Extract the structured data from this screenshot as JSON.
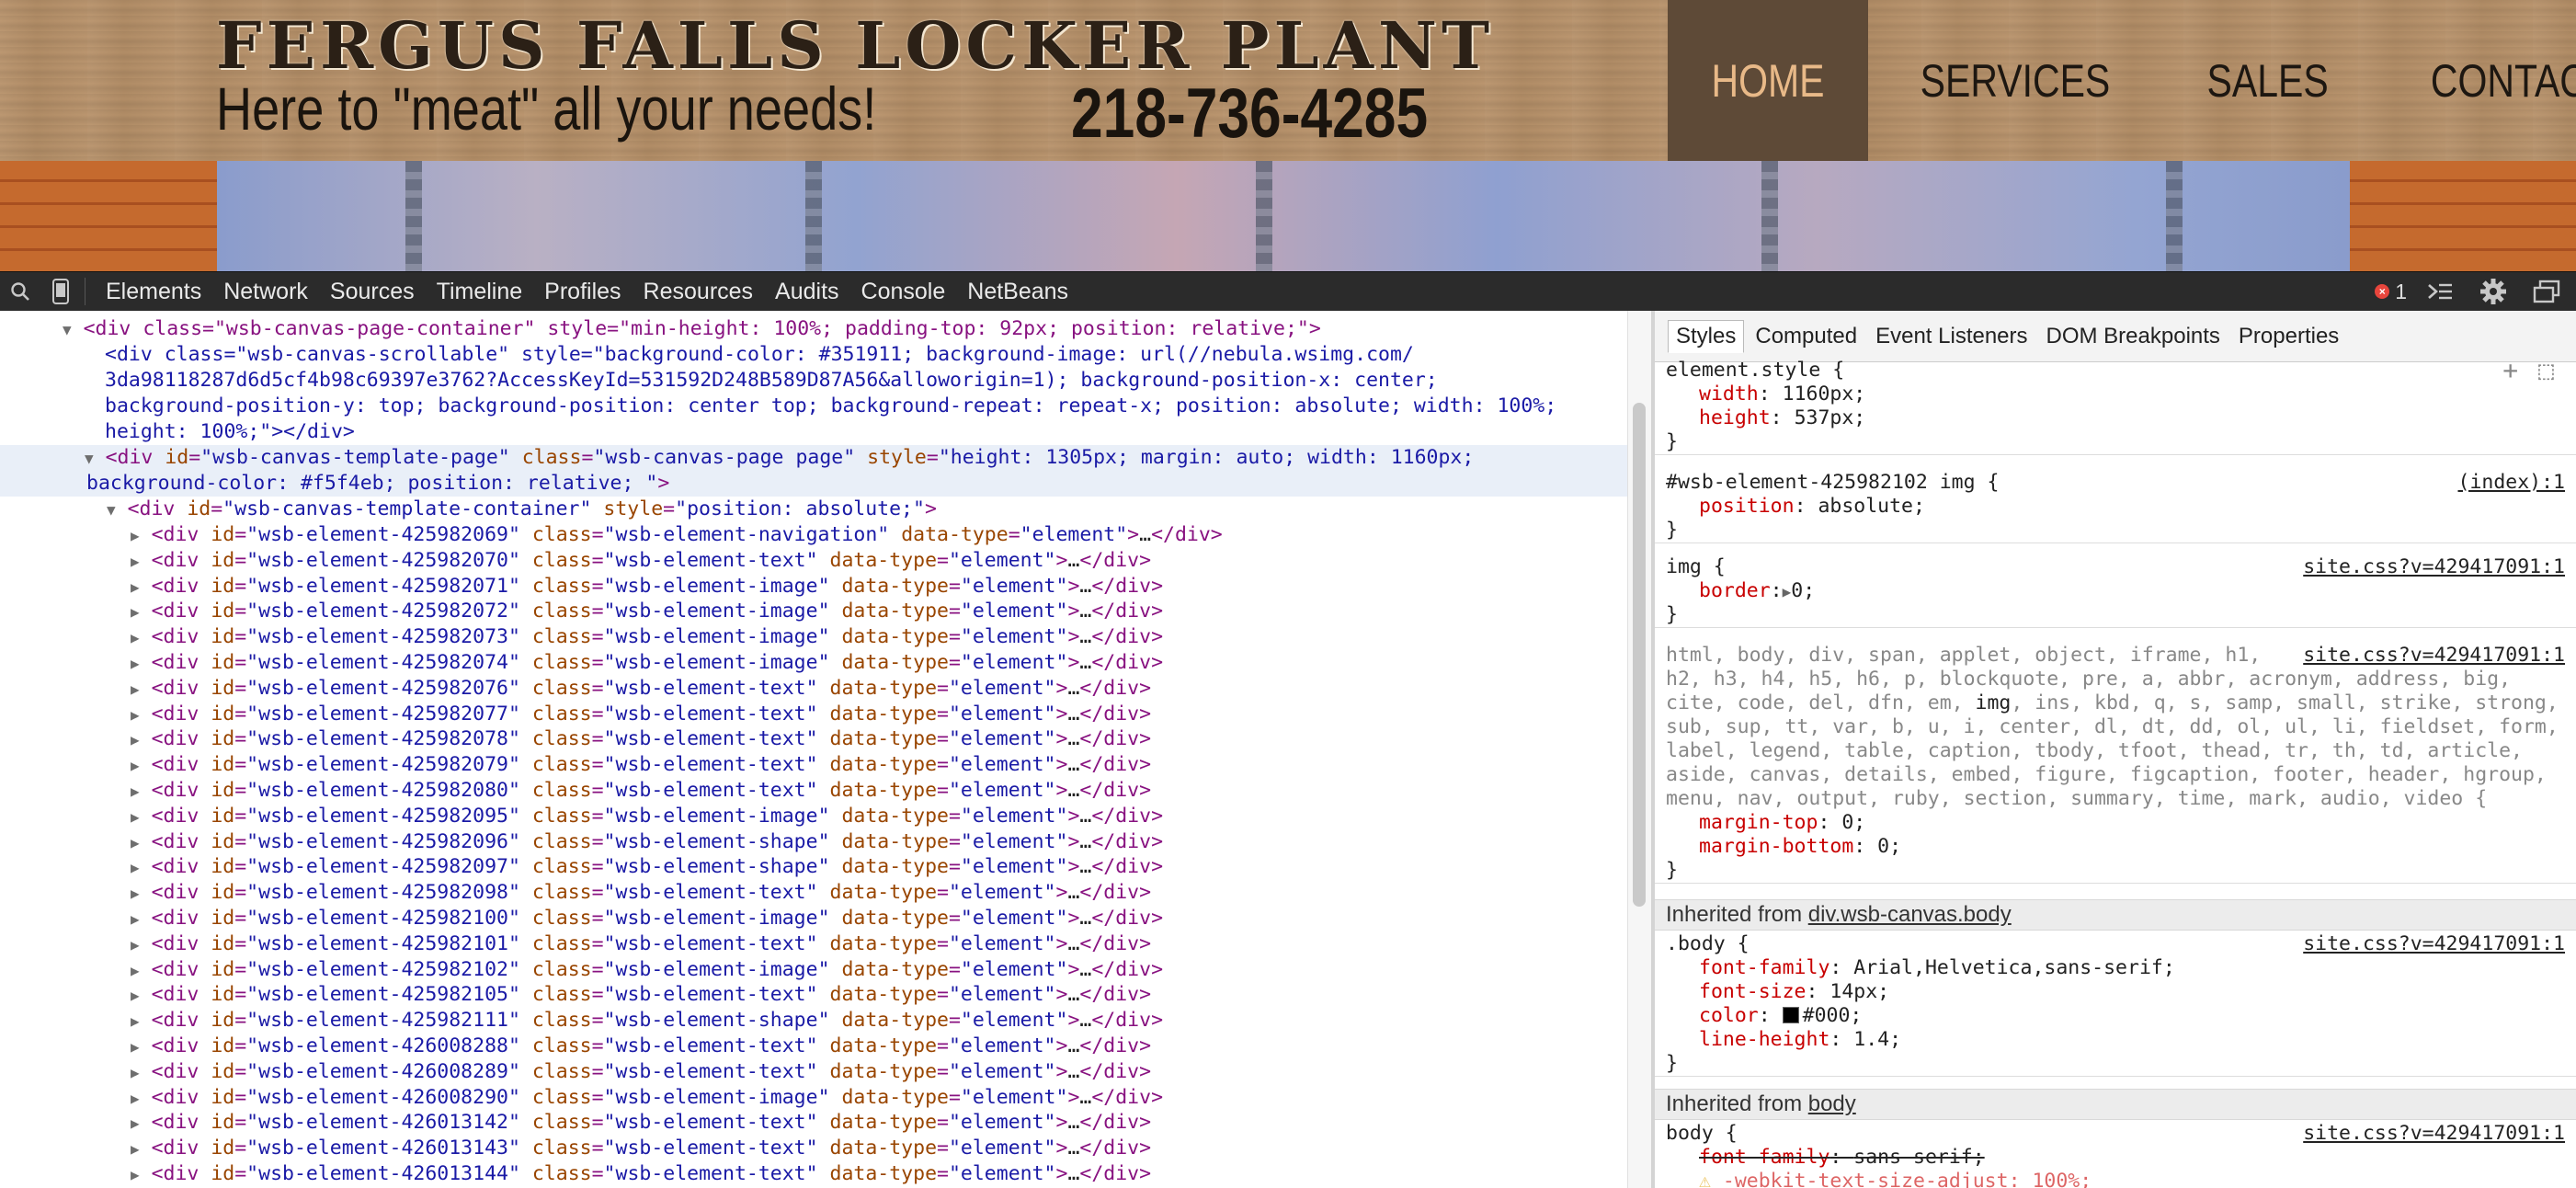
{
  "site": {
    "brand_title": "FERGUS FALLS LOCKER PLANT",
    "tagline": "Here to \"meat\" all your needs!",
    "phone": "218-736-4285",
    "nav": [
      "HOME",
      "SERVICES",
      "SALES",
      "CONTACT US"
    ],
    "active_nav": "HOME"
  },
  "devtools": {
    "tabs": [
      "Elements",
      "Network",
      "Sources",
      "Timeline",
      "Profiles",
      "Resources",
      "Audits",
      "Console",
      "NetBeans"
    ],
    "error_count": "1",
    "icons": [
      "search-icon",
      "device-mode-icon",
      "console-drawer-icon",
      "gear-icon",
      "dock-icon"
    ]
  },
  "elements": {
    "container_open": "<div class=\"wsb-canvas-page-container\" style=\"min-height: 100%; padding-top: 92px; position: relative;\">",
    "scrollable_lines": [
      "<div class=\"wsb-canvas-scrollable\" style=\"background-color: #351911; background-image: url(//nebula.wsimg.com/",
      "3da98118287d6d5cf4b98c69397e3762?AccessKeyId=531592D248B589D87A56&alloworigin=1); background-position-x: center;",
      "background-position-y: top; background-position: center top; background-repeat: repeat-x; position: absolute; width: 100%;",
      "height: 100%;\"></div>"
    ],
    "template_page": {
      "id": "wsb-canvas-template-page",
      "class": "wsb-canvas-page page",
      "style_line1": "height: 1305px; margin: auto; width: 1160px;",
      "style_line2": "background-color: #f5f4eb; position: relative; "
    },
    "template_container": {
      "id": "wsb-canvas-template-container",
      "style": "position: absolute;"
    },
    "element_rows": [
      {
        "id": "wsb-element-425982069",
        "cls": "wsb-element-navigation"
      },
      {
        "id": "wsb-element-425982070",
        "cls": "wsb-element-text"
      },
      {
        "id": "wsb-element-425982071",
        "cls": "wsb-element-image"
      },
      {
        "id": "wsb-element-425982072",
        "cls": "wsb-element-image"
      },
      {
        "id": "wsb-element-425982073",
        "cls": "wsb-element-image"
      },
      {
        "id": "wsb-element-425982074",
        "cls": "wsb-element-image"
      },
      {
        "id": "wsb-element-425982076",
        "cls": "wsb-element-text"
      },
      {
        "id": "wsb-element-425982077",
        "cls": "wsb-element-text"
      },
      {
        "id": "wsb-element-425982078",
        "cls": "wsb-element-text"
      },
      {
        "id": "wsb-element-425982079",
        "cls": "wsb-element-text"
      },
      {
        "id": "wsb-element-425982080",
        "cls": "wsb-element-text"
      },
      {
        "id": "wsb-element-425982095",
        "cls": "wsb-element-image"
      },
      {
        "id": "wsb-element-425982096",
        "cls": "wsb-element-shape"
      },
      {
        "id": "wsb-element-425982097",
        "cls": "wsb-element-shape"
      },
      {
        "id": "wsb-element-425982098",
        "cls": "wsb-element-text"
      },
      {
        "id": "wsb-element-425982100",
        "cls": "wsb-element-image"
      },
      {
        "id": "wsb-element-425982101",
        "cls": "wsb-element-text"
      },
      {
        "id": "wsb-element-425982102",
        "cls": "wsb-element-image"
      },
      {
        "id": "wsb-element-425982105",
        "cls": "wsb-element-text"
      },
      {
        "id": "wsb-element-425982111",
        "cls": "wsb-element-shape"
      },
      {
        "id": "wsb-element-426008288",
        "cls": "wsb-element-text"
      },
      {
        "id": "wsb-element-426008289",
        "cls": "wsb-element-text"
      },
      {
        "id": "wsb-element-426008290",
        "cls": "wsb-element-image"
      },
      {
        "id": "wsb-element-426013142",
        "cls": "wsb-element-text"
      },
      {
        "id": "wsb-element-426013143",
        "cls": "wsb-element-text"
      },
      {
        "id": "wsb-element-426013144",
        "cls": "wsb-element-text"
      }
    ],
    "data_type_value": "element"
  },
  "sidebar": {
    "tabs": [
      "Styles",
      "Computed",
      "Event Listeners",
      "DOM Breakpoints",
      "Properties"
    ],
    "active_tab": "Styles",
    "element_style": {
      "selector": "element.style {",
      "props": [
        [
          "width",
          "1160px;"
        ],
        [
          "height",
          "537px;"
        ]
      ]
    },
    "rule_img_abs": {
      "selector": "#wsb-element-425982102 img {",
      "source": "(index):1",
      "props": [
        [
          "position",
          "absolute;"
        ]
      ]
    },
    "rule_img": {
      "selector": "img {",
      "source": "site.css?v=429417091:1",
      "props": [
        [
          "border",
          "0;"
        ]
      ]
    },
    "rule_reset": {
      "selector_lines": [
        "html, body, div, span, applet, object, iframe, h1,",
        "h2, h3, h4, h5, h6, p, blockquote, pre, a, abbr, acronym, address, big,",
        "cite, code, del, dfn, em, img, ins, kbd, q, s, samp, small, strike, strong,",
        "sub, sup, tt, var, b, u, i, center, dl, dt, dd, ol, ul, li, fieldset, form,",
        "label, legend, table, caption, tbody, tfoot, thead, tr, th, td, article,",
        "aside, canvas, details, embed, figure, figcaption, footer, header, hgroup,",
        "menu, nav, output, ruby, section, summary, time, mark, audio, video {"
      ],
      "source": "site.css?v=429417091:1",
      "props": [
        [
          "margin-top",
          "0;"
        ],
        [
          "margin-bottom",
          "0;"
        ]
      ]
    },
    "inherited_1": {
      "prefix": "Inherited from ",
      "link": "div.wsb-canvas.body"
    },
    "rule_body_class": {
      "selector": ".body {",
      "source": "site.css?v=429417091:1",
      "props": [
        [
          "font-family",
          "Arial,Helvetica,sans-serif;"
        ],
        [
          "font-size",
          "14px;"
        ],
        [
          "color",
          "#000;"
        ],
        [
          "line-height",
          "1.4;"
        ]
      ]
    },
    "inherited_2": {
      "prefix": "Inherited from ",
      "link": "body"
    },
    "rule_body": {
      "selector": "body {",
      "source": "site.css?v=429417091:1",
      "struck_prop": [
        "font-family",
        "sans-serif;"
      ],
      "partial_line": "-webkit-text-size-adjust: 100%;"
    },
    "closing_brace": "}"
  },
  "colors": {
    "toolbar_bg": "#2b2b2b",
    "nav_active_bg": "#5e4a37",
    "nav_active_text": "#e8b988",
    "tag": "#881280",
    "attr_name": "#994500",
    "attr_value": "#1a1aa6",
    "prop_name": "#c80000"
  }
}
